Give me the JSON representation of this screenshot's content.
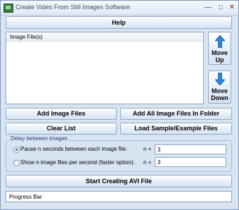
{
  "window": {
    "title": "Create Video From Still Images Software",
    "controls": {
      "minimize": "—",
      "maximize": "□",
      "close": "✕"
    }
  },
  "toolbar": {
    "help_label": "Help"
  },
  "list": {
    "header": "Image File(s)",
    "items": []
  },
  "move": {
    "up_label": [
      "Move",
      "Up"
    ],
    "down_label": [
      "Move",
      "Down"
    ]
  },
  "actions": {
    "add_image_files": "Add Image Files",
    "add_all_in_folder": "Add All Image Files In Folder",
    "clear_list": "Clear List",
    "load_sample": "Load Sample/Example Files"
  },
  "delay": {
    "legend": "Delay between images",
    "options": [
      {
        "label": "Pause n seconds between each image file:",
        "n_label": "n =",
        "value": "3",
        "selected": true
      },
      {
        "label": "Show n image files per second (faster option):",
        "n_label": "n =",
        "value": "3",
        "selected": false
      }
    ]
  },
  "start": {
    "label": "Start Creating AVI File"
  },
  "progress": {
    "label": "Progress Bar"
  },
  "colors": {
    "accent": "#2f86d6",
    "window_bg": "#d8e4f2"
  },
  "icons": {
    "up": "arrow-up-icon",
    "down": "arrow-down-icon",
    "app": "app-icon"
  }
}
